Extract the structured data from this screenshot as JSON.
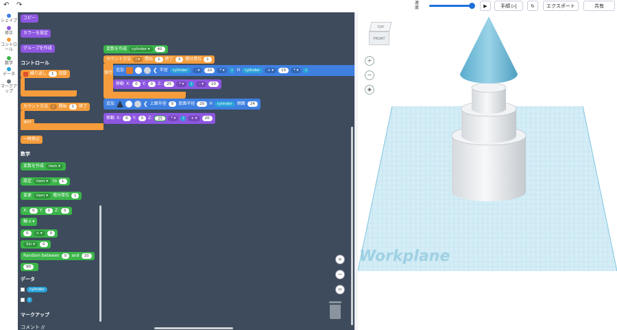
{
  "toolbar": {
    "speed_label": "速度",
    "step_label": "手順",
    "export_label": "エクスポート",
    "share_label": "共有"
  },
  "rail": {
    "items": [
      {
        "label": "シェイプ",
        "color": "#3f7fe0"
      },
      {
        "label": "修正",
        "color": "#8d57e0"
      },
      {
        "label": "コントロール",
        "color": "#f59c3c"
      },
      {
        "label": "数学",
        "color": "#3bb54a"
      },
      {
        "label": "データ",
        "color": "#2ba3d8"
      },
      {
        "label": "マークアップ",
        "color": "#6b7785"
      }
    ]
  },
  "palette": {
    "copy": "コピー",
    "set_color": "カラーを設定",
    "create_group": "グループを作成",
    "control_header": "コントロール",
    "repeat": "繰り返し",
    "repeat_count": "1",
    "repeat_unit": "回数",
    "count_with": "カウント方法",
    "count_var": "i",
    "count_start_label": "開始",
    "count_start": "1",
    "count_end_label": "終了",
    "do_label": "実行",
    "pause": "一時停止",
    "math_header": "数学",
    "create_var": "変数を作成",
    "var_item": "item",
    "set_label": "設定",
    "to_label": "to",
    "to_value": "1",
    "change_label": "変更",
    "change_step_label": "増分単位",
    "change_step": "1",
    "x_label": "X:",
    "x_val": "0",
    "y_label": "Y:",
    "y_val": "0",
    "z_label": "Z:",
    "z_val": "0",
    "axis": "軸 x",
    "op_a": "0",
    "op": "+",
    "op_b": "0",
    "sin": "Sin",
    "sin_val": "0",
    "random_label": "Random between",
    "random_a": "0",
    "random_and": "and",
    "random_b": "10",
    "ninety": "90",
    "data_header": "データ",
    "data_var1": "cylinder",
    "data_var2": "i",
    "markup_header": "マークアップ",
    "comment": "コメント //"
  },
  "workspace": {
    "create_var": "変数を作成",
    "var_name": "cylinder",
    "var_value": "40",
    "count_with": "カウント方法",
    "count_var": "i",
    "start_label": "開始",
    "start_val": "1",
    "end_label": "終了",
    "end_val": "3",
    "step_label": "増分単位",
    "step_val": "1",
    "do_label": "実行",
    "add1": "追加",
    "radius_label": "半径",
    "radius_var": "cylinder",
    "minus": "-",
    "ten_a": "10",
    "times": "*",
    "i1": "i",
    "h_label": "H",
    "h_var": "cylinder",
    "plus": "+",
    "ten_b": "10",
    "i2": "i",
    "move1": "移動",
    "m1_x_label": "X:",
    "m1_x": "0",
    "m1_y_label": "Y:",
    "m1_y": "0",
    "m1_z_label": "Z:",
    "m1_z_a": "25",
    "m1_i": "i",
    "m1_minus": "-",
    "m1_z_b": "10",
    "add2": "追加",
    "top_radius_label": "上面半径",
    "top_radius": "0",
    "bottom_radius_label": "底面半径",
    "bottom_radius": "20",
    "h2_label": "H",
    "h2_var": "cylinder",
    "sides_label": "側面",
    "sides": "24",
    "move2": "移動",
    "m2_x_label": "X:",
    "m2_x": "0",
    "m2_y_label": "Y:",
    "m2_y": "0",
    "m2_z_label": "Z:",
    "m2_z_a": "25",
    "m2_times": "*",
    "m2_i": "i",
    "m2_plus": "+",
    "m2_z_b": "20"
  },
  "viewport": {
    "view_cube_top": "TOP",
    "view_cube_front": "FRONT",
    "workplane_label": "Workplane"
  },
  "colors": {
    "workspace_bg": "#3d4b5c",
    "grid": "#bfe3ef",
    "cone": "#7ec3df"
  }
}
